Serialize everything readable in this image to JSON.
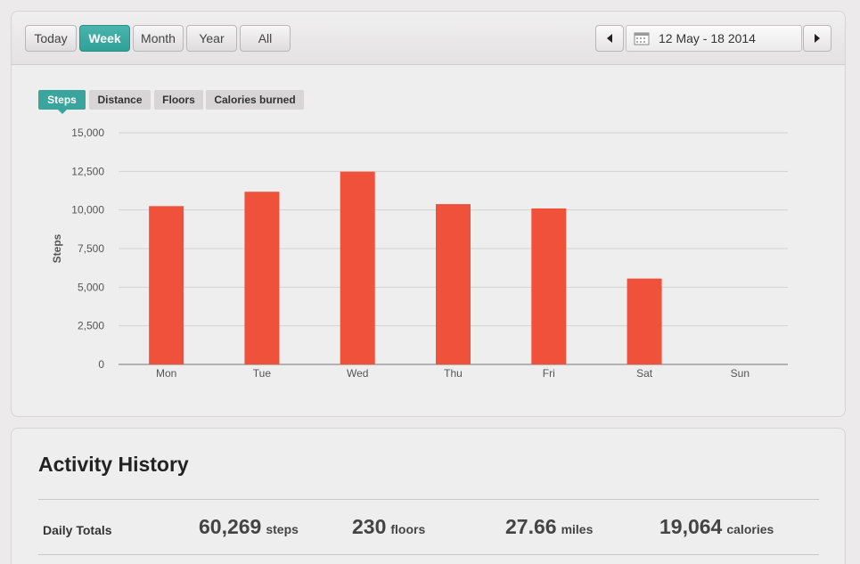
{
  "toolbar": {
    "periods": [
      "Today",
      "Week",
      "Month",
      "Year",
      "All"
    ],
    "active_period": "Week",
    "date_range": "12 May - 18 2014"
  },
  "metric_tabs": [
    "Steps",
    "Distance",
    "Floors",
    "Calories burned"
  ],
  "active_metric": "Steps",
  "colors": {
    "accent": "#3aa59d",
    "bar": "#f0513a"
  },
  "chart_data": {
    "type": "bar",
    "categories": [
      "Mon",
      "Tue",
      "Wed",
      "Thu",
      "Fri",
      "Sat",
      "Sun"
    ],
    "values": [
      10250,
      11180,
      12480,
      10380,
      10100,
      5560,
      0
    ],
    "ylabel": "Steps",
    "ylim": [
      0,
      15000
    ],
    "yticks": [
      "0",
      "2,500",
      "5,000",
      "7,500",
      "10,000",
      "12,500",
      "15,000"
    ],
    "grid": true
  },
  "activity_history": {
    "title": "Activity History",
    "daily_totals_label": "Daily Totals",
    "totals": [
      {
        "value": "60,269",
        "unit": "steps"
      },
      {
        "value": "230",
        "unit": "floors"
      },
      {
        "value": "27.66",
        "unit": "miles"
      },
      {
        "value": "19,064",
        "unit": "calories"
      }
    ]
  }
}
